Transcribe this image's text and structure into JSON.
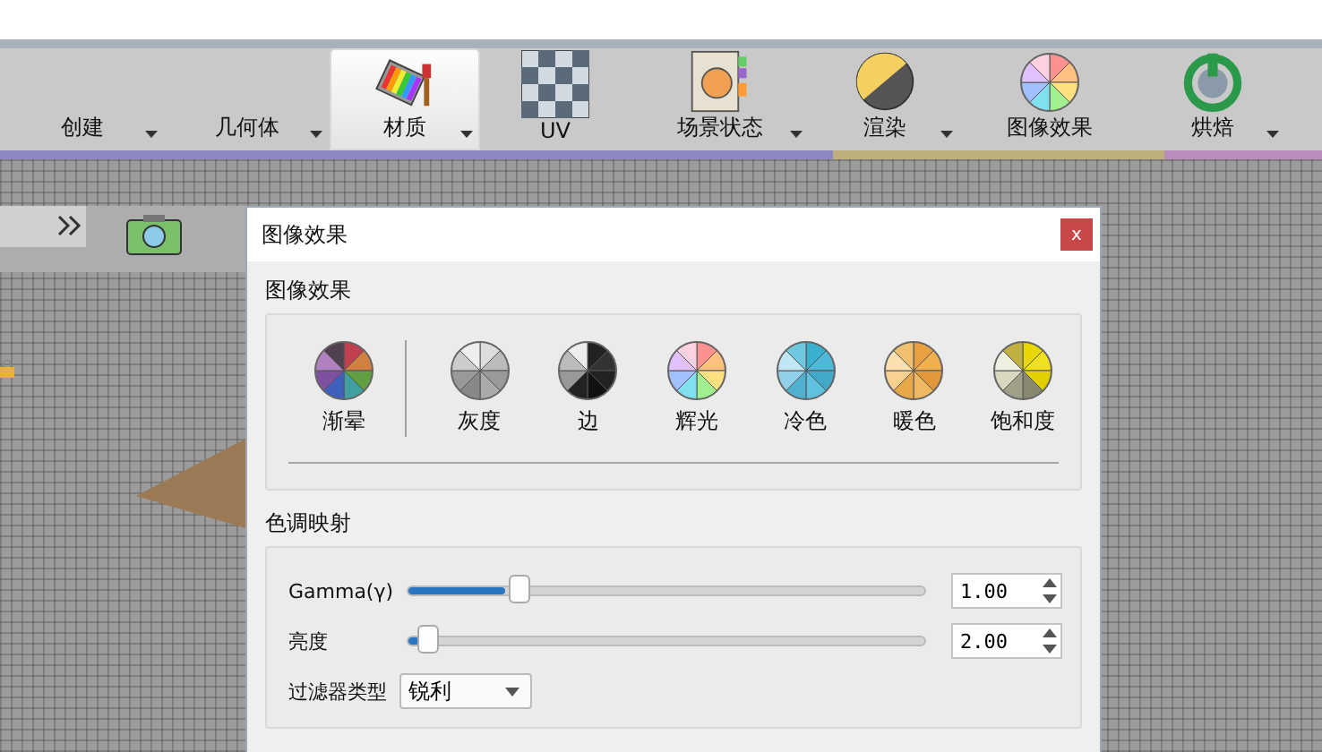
{
  "toolbar": {
    "items": [
      {
        "label": "创建",
        "kind": "plain",
        "selected": false,
        "dropdown": true
      },
      {
        "label": "几何体",
        "kind": "plain",
        "selected": false,
        "dropdown": true
      },
      {
        "label": "材质",
        "kind": "material",
        "selected": true,
        "dropdown": true
      },
      {
        "label": "UV",
        "kind": "uv",
        "selected": false,
        "dropdown": false
      },
      {
        "label": "场景状态",
        "kind": "scene",
        "selected": false,
        "dropdown": true
      },
      {
        "label": "渲染",
        "kind": "render",
        "selected": false,
        "dropdown": true
      },
      {
        "label": "图像效果",
        "kind": "effects",
        "selected": false,
        "dropdown": false
      },
      {
        "label": "烘焙",
        "kind": "bake",
        "selected": false,
        "dropdown": true
      }
    ]
  },
  "dialog": {
    "title": "图像效果",
    "close": "x",
    "effects_section": {
      "label": "图像效果",
      "items": [
        {
          "label": "渐晕",
          "kind": "vignette"
        },
        {
          "label": "灰度",
          "kind": "gray"
        },
        {
          "label": "边",
          "kind": "edge"
        },
        {
          "label": "辉光",
          "kind": "glow"
        },
        {
          "label": "冷色",
          "kind": "cool"
        },
        {
          "label": "暖色",
          "kind": "warm"
        },
        {
          "label": "饱和度",
          "kind": "saturation"
        }
      ]
    },
    "tone_section": {
      "label": "色调映射",
      "sliders": [
        {
          "label": "Gamma(γ)",
          "level": 0.21,
          "value": "1.00"
        },
        {
          "label": "亮度",
          "level": 0.04,
          "value": "2.00"
        }
      ],
      "filter": {
        "label": "过滤器类型",
        "value": "锐利"
      }
    }
  }
}
